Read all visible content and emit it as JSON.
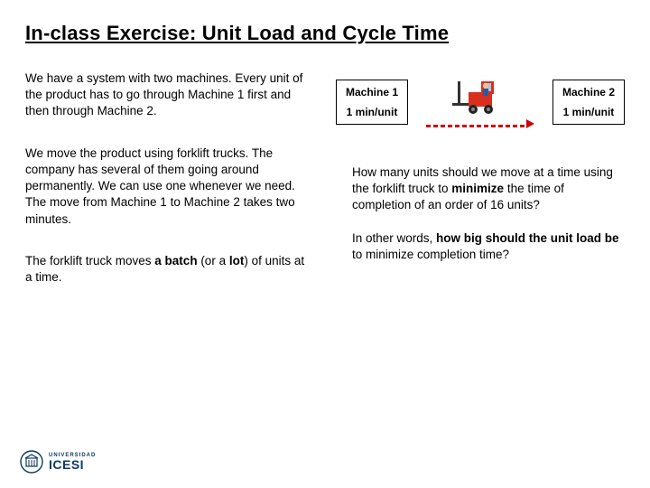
{
  "title": "In-class Exercise: Unit Load and Cycle Time",
  "paragraphs": {
    "p1": "We have a system with two machines. Every unit of the product has to go through Machine 1 first and then through Machine 2.",
    "p2": "We move the product using forklift trucks. The company has several of them going around permanently. We can use one whenever we need. The move from Machine 1 to Machine 2 takes two minutes.",
    "p3_prefix": "The forklift truck moves ",
    "p3_bold1": "a batch",
    "p3_mid": " (or a ",
    "p3_bold2": "lot",
    "p3_suffix": ") of units at a time."
  },
  "diagram": {
    "machine1": {
      "name": "Machine 1",
      "rate": "1 min/unit"
    },
    "machine2": {
      "name": "Machine 2",
      "rate": "1 min/unit"
    },
    "transport_icon": "forklift-icon"
  },
  "question": {
    "q1_prefix": "How many units should we move at a time using the forklift truck  to ",
    "q1_bold": "minimize",
    "q1_suffix": " the time of completion of an order of 16 units?",
    "q2_prefix": "In other words, ",
    "q2_bold": "how big should the unit load be",
    "q2_suffix": " to minimize completion time?"
  },
  "logo": {
    "university": "UNIVERSIDAD",
    "name": "ICESI"
  }
}
